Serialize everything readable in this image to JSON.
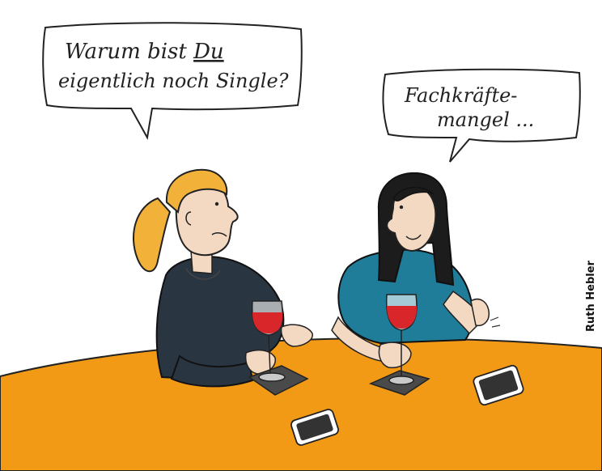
{
  "cartoon": {
    "left_bubble": {
      "line1_before": "Warum bist ",
      "line1_emph": "Du",
      "line2": "eigentlich noch Single?"
    },
    "right_bubble": {
      "line1": "Fachkräfte-",
      "line2": "mangel ..."
    },
    "credit": "Ruth Hebler"
  },
  "colors": {
    "table": "#f29a16",
    "wine": "#d9262b",
    "left_hair": "#f2b23a",
    "left_shirt": "#2a3542",
    "right_hair": "#1c1c1c",
    "right_shirt": "#1f7d9a",
    "skin": "#f3d9c2"
  }
}
